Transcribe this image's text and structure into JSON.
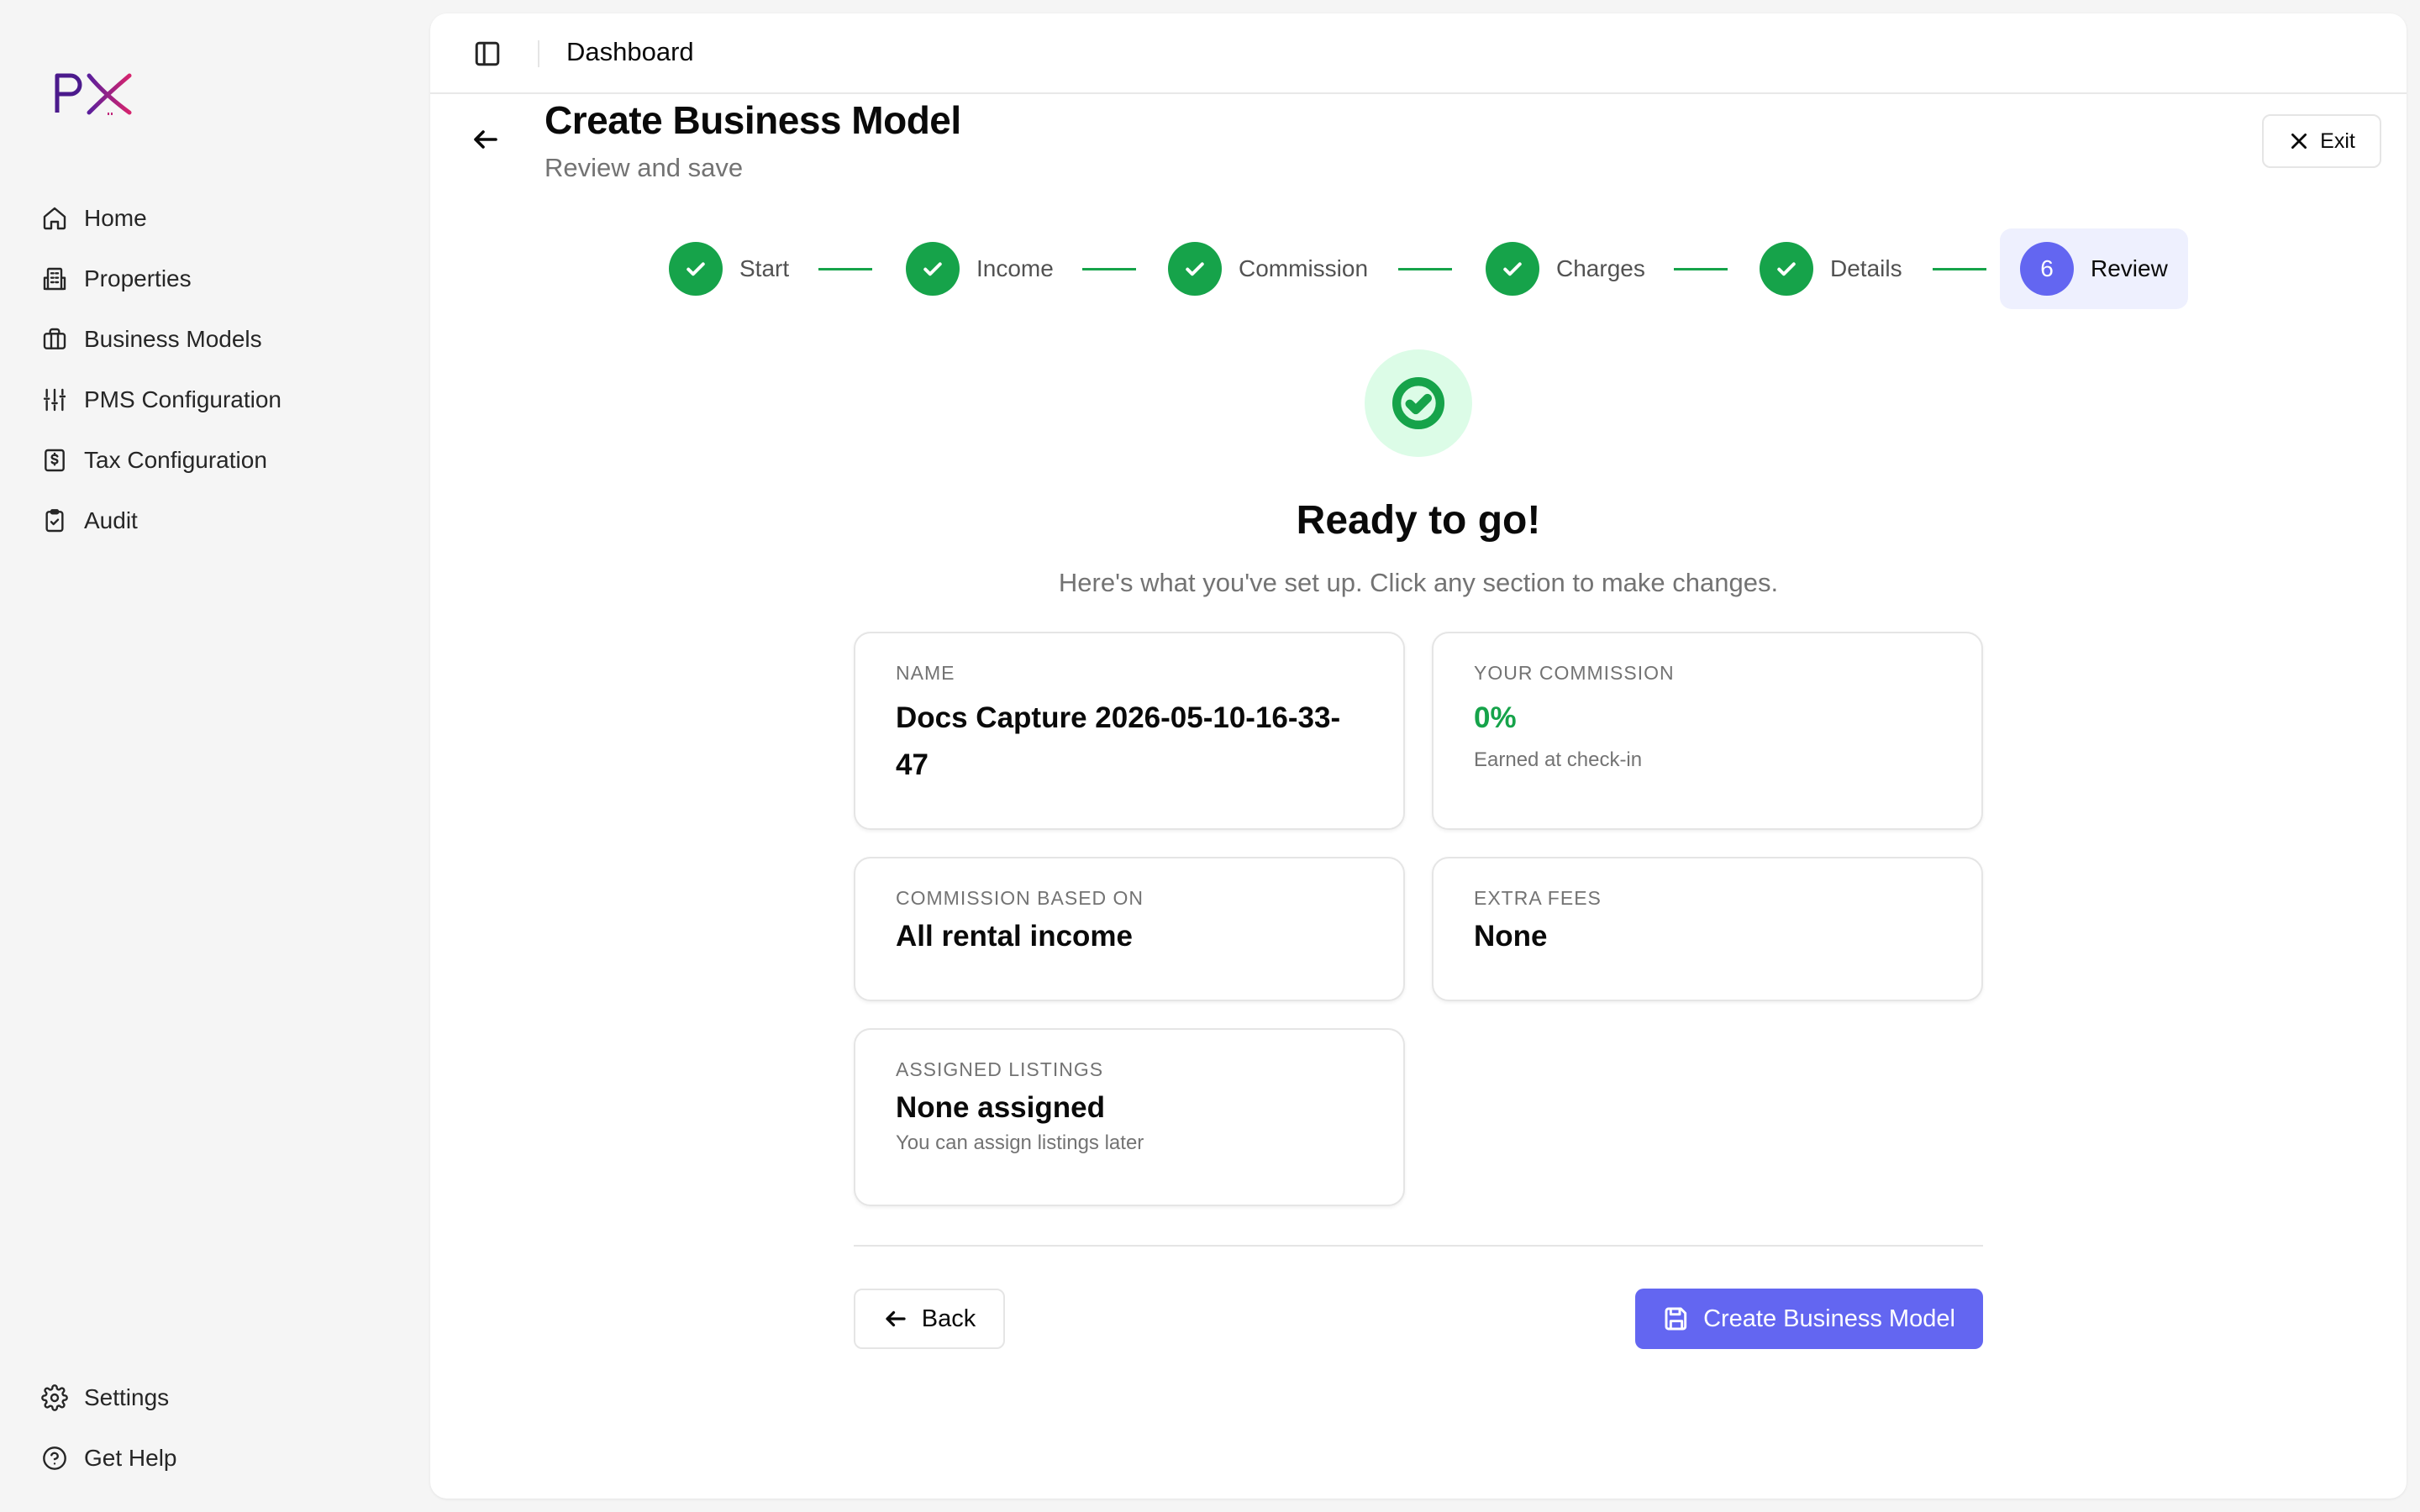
{
  "brand": {
    "logo_text": "PX",
    "accent": "#6366f1",
    "success": "#16a34a"
  },
  "sidebar": {
    "items": [
      {
        "label": "Home",
        "icon": "home-icon"
      },
      {
        "label": "Properties",
        "icon": "building-icon"
      },
      {
        "label": "Business Models",
        "icon": "briefcase-icon"
      },
      {
        "label": "PMS Configuration",
        "icon": "sliders-icon"
      },
      {
        "label": "Tax Configuration",
        "icon": "receipt-icon"
      },
      {
        "label": "Audit",
        "icon": "clipboard-check-icon"
      }
    ],
    "bottom": [
      {
        "label": "Settings",
        "icon": "gear-icon"
      },
      {
        "label": "Get Help",
        "icon": "help-circle-icon"
      }
    ]
  },
  "header": {
    "title": "Dashboard"
  },
  "page": {
    "title": "Create Business Model",
    "subtitle": "Review and save",
    "exit_label": "Exit"
  },
  "stepper": {
    "steps": [
      {
        "label": "Start",
        "status": "complete"
      },
      {
        "label": "Income",
        "status": "complete"
      },
      {
        "label": "Commission",
        "status": "complete"
      },
      {
        "label": "Charges",
        "status": "complete"
      },
      {
        "label": "Details",
        "status": "complete"
      },
      {
        "label": "Review",
        "status": "active",
        "number": "6"
      }
    ]
  },
  "summary": {
    "title": "Ready to go!",
    "subtitle": "Here's what you've set up. Click any section to make changes."
  },
  "cards": {
    "name": {
      "label": "NAME",
      "value": "Docs Capture 2026-05-10-16-33-47"
    },
    "commission": {
      "label": "YOUR COMMISSION",
      "value": "0%",
      "note": "Earned at check-in"
    },
    "based_on": {
      "label": "COMMISSION BASED ON",
      "value": "All rental income"
    },
    "extra_fees": {
      "label": "EXTRA FEES",
      "value": "None"
    },
    "listings": {
      "label": "ASSIGNED LISTINGS",
      "value": "None assigned",
      "note": "You can assign listings later"
    }
  },
  "actions": {
    "back_label": "Back",
    "create_label": "Create Business Model"
  }
}
